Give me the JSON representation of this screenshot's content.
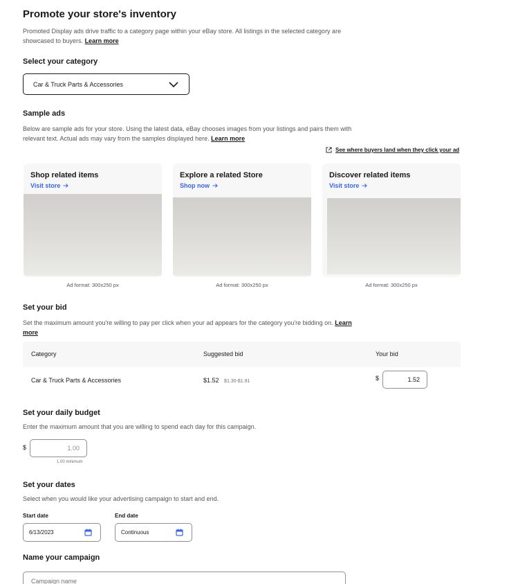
{
  "header": {
    "title": "Promote your store's inventory",
    "description": "Promoted Display ads drive traffic to a category page within your eBay store. All listings in the selected category are showcased to buyers.",
    "learn_more": "Learn more"
  },
  "category_section": {
    "label": "Select your category",
    "selected": "Car & Truck Parts & Accessories"
  },
  "sample_ads": {
    "title": "Sample ads",
    "description": "Below are sample ads for your store. Using the latest data, eBay chooses images from your listings and pairs them with relevant text. Actual ads may vary from the samples displayed here.",
    "learn_more": "Learn more",
    "buyers_link": "See where buyers land when they click your ad",
    "cards": [
      {
        "title": "Shop related items",
        "link": "Visit store",
        "format": "Ad format: 300x250 px"
      },
      {
        "title": "Explore a related Store",
        "link": "Shop now",
        "format": "Ad format: 300x250 px"
      },
      {
        "title": "Discover related items",
        "link": "Visit store",
        "format": "Ad format: 300x250 px"
      }
    ]
  },
  "bid": {
    "title": "Set your bid",
    "description": "Set the maximum amount you're willing to pay per click when your ad appears for the category you're bidding on.",
    "learn_more": "Learn more",
    "columns": [
      "Category",
      "Suggested bid",
      "Your bid"
    ],
    "row": {
      "category": "Car & Truck Parts & Accessories",
      "suggested": "$1.52",
      "range": "$1.30-$1.91",
      "currency": "$",
      "your_bid": "1.52"
    }
  },
  "budget": {
    "title": "Set your daily budget",
    "description": "Enter the maximum amount that you are willing to spend each day for this campaign.",
    "currency": "$",
    "value": "1.00",
    "minimum": "1.00 minimum"
  },
  "dates": {
    "title": "Set your dates",
    "description": "Select when you would like your advertising campaign to start and end.",
    "start_label": "Start date",
    "start_value": "6/13/2023",
    "end_label": "End date",
    "end_value": "Continuous"
  },
  "campaign": {
    "title": "Name your campaign",
    "placeholder": "Campaign name"
  },
  "icons": {
    "chevron": "chevron-down-icon",
    "arrow": "arrow-right-icon",
    "external": "external-link-icon",
    "calendar": "calendar-icon"
  },
  "colors": {
    "link_blue": "#3665f3",
    "text": "#191919",
    "card_bg": "#f7f7f7"
  }
}
